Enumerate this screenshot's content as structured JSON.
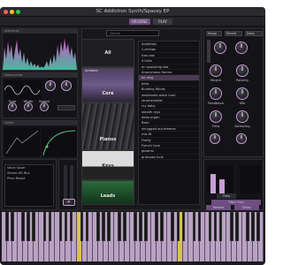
{
  "window": {
    "title": "SC Addiction Synth/Spacey EP"
  },
  "topbar": {
    "browse_label": "BROWSE",
    "play_label": "PLAY"
  },
  "panels": {
    "spectrum": "SPECTRUM",
    "modulation": "MODULATION",
    "filter": "FILTER",
    "envelope": "ENVELOPE",
    "range": "Range",
    "reverb": "Reverb",
    "delay": "Delay"
  },
  "knobs": {
    "tone": "Tone",
    "width": "Width",
    "speed": "Speed",
    "morph": "Morph",
    "polarity": "Polarity",
    "feedback": "Feedback",
    "mix": "Mix",
    "freq": "Freq",
    "damping": "Damping"
  },
  "toggles": {
    "freq": "Freq",
    "filter_freq": "Filter Freq",
    "reverb": "Reverb",
    "delay": "Delay"
  },
  "browser": {
    "search_placeholder": "Search",
    "categories": [
      "All",
      "Ambient",
      "Core",
      "Pianos",
      "Keys",
      "Leads"
    ],
    "presets": [
      "Ambitiols",
      "Curnhips",
      "fuss box",
      "4 ticks",
      "on spacemig stw",
      "Anonymous Harmo",
      "bo ding",
      "bells",
      "Building Winds",
      "wishlisstle witch hunt",
      "stramentalist",
      "cry baby",
      "stealth rays",
      "deep organ",
      "flash",
      "shrugged out dreams",
      "mis-fit",
      "Firefly",
      "French horn",
      "glowms",
      "grampas funk"
    ]
  },
  "preset_list_panel": {
    "items": [
      "Value Saver",
      "Stereo HD Blur",
      "Phon Resist"
    ]
  },
  "colors": {
    "accent": "#c99bd8",
    "bg": "#1c1b20",
    "panel": "#141317"
  }
}
